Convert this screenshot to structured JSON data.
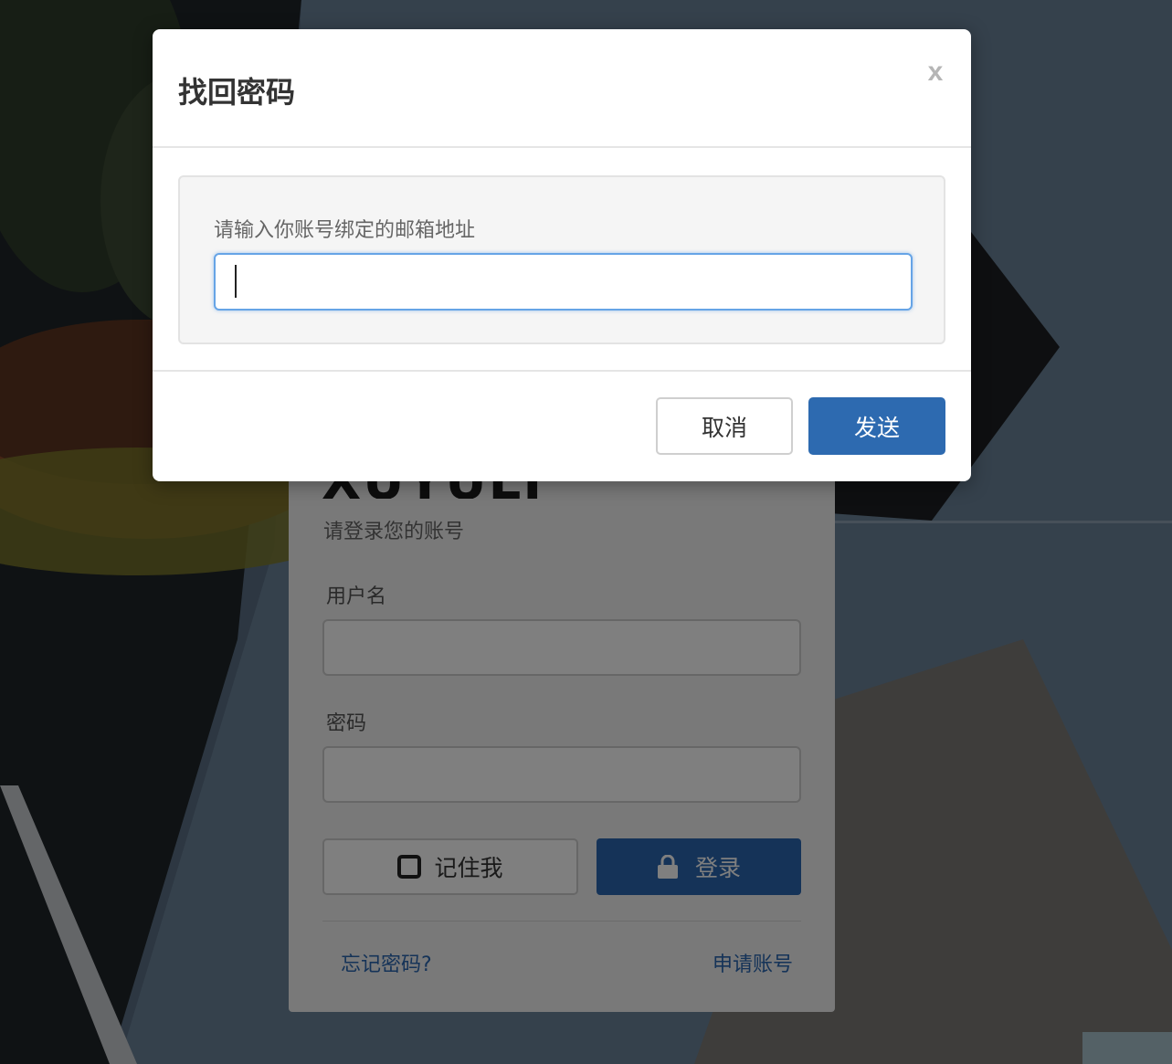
{
  "colors": {
    "primary": "#2d6ab0",
    "link": "#2a66b1",
    "focus_border": "#66a4e6"
  },
  "login": {
    "brand": "XUYULI",
    "subtitle": "请登录您的账号",
    "username_label": "用户名",
    "password_label": "密码",
    "remember_label": "记住我",
    "remember_icon": "checkbox-unchecked-icon",
    "login_label": "登录",
    "login_icon": "lock-icon",
    "forgot_link": "忘记密码?",
    "register_link": "申请账号"
  },
  "dialog": {
    "title": "找回密码",
    "close_label": "x",
    "email_label": "请输入你账号绑定的邮箱地址",
    "email_value": "",
    "cancel_label": "取消",
    "send_label": "发送"
  }
}
